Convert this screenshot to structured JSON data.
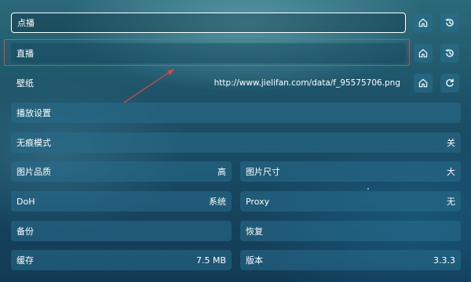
{
  "rows": {
    "vod": {
      "label": "点播"
    },
    "live": {
      "label": "直播"
    },
    "wallpaper": {
      "label": "壁纸",
      "value": "http://www.jielifan.com/data/f_95575706.png"
    },
    "playback_settings": {
      "label": "播放设置"
    },
    "incognito": {
      "label": "无痕模式",
      "value": "关"
    },
    "image_quality": {
      "label": "图片品质",
      "value": "高"
    },
    "image_size": {
      "label": "图片尺寸",
      "value": "大"
    },
    "doh": {
      "label": "DoH",
      "value": "系统"
    },
    "proxy": {
      "label": "Proxy",
      "value": "无"
    },
    "backup": {
      "label": "备份"
    },
    "restore": {
      "label": "恢复"
    },
    "cache": {
      "label": "缓存",
      "value": "7.5 MB"
    },
    "version": {
      "label": "版本",
      "value": "3.3.3"
    }
  },
  "icons": {
    "home": "home-icon",
    "history": "history-icon",
    "refresh": "refresh-icon"
  },
  "colors": {
    "annotation": "#d94848",
    "row_bg": "#286e8c",
    "text": "#ffffff"
  }
}
